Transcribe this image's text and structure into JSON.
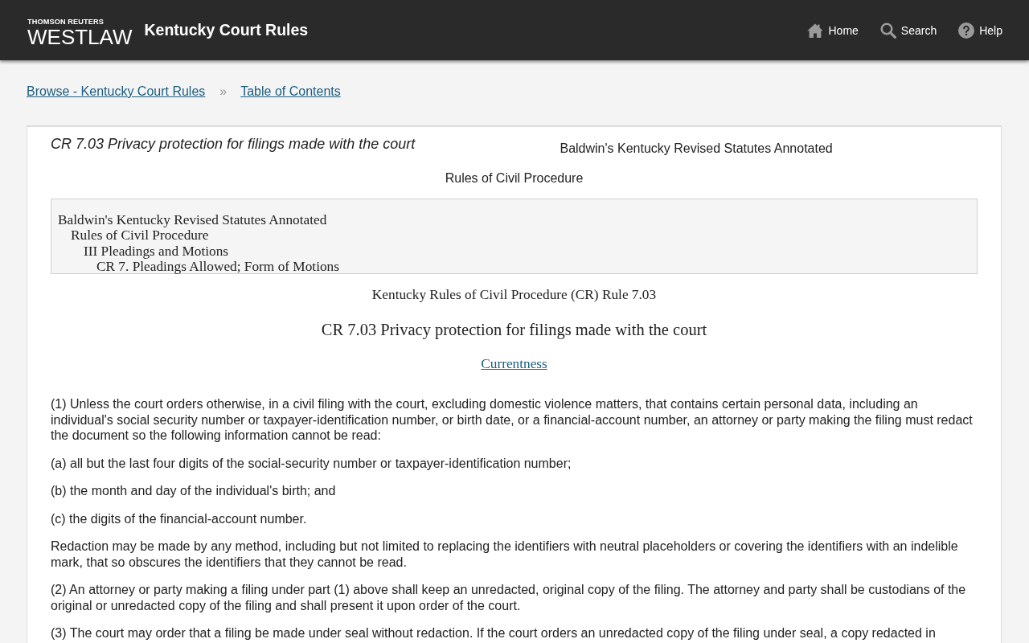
{
  "header": {
    "logo": {
      "company": "THOMSON REUTERS",
      "product": "WESTLAW"
    },
    "title": "Kentucky Court Rules",
    "nav": [
      {
        "kind": "home",
        "label": "Home"
      },
      {
        "kind": "search",
        "label": "Search"
      },
      {
        "kind": "help",
        "label": "Help"
      }
    ]
  },
  "breadcrumbs": {
    "items": [
      "Browse - Kentucky Court Rules",
      "Table of Contents"
    ],
    "separator": "»"
  },
  "document": {
    "running_title": "CR 7.03 Privacy protection for filings made with the court",
    "source": "Baldwin's Kentucky Revised Statutes Annotated",
    "subtitle": "Rules of Civil Procedure",
    "outline": [
      {
        "label": "Baldwin's Kentucky Revised Statutes Annotated",
        "children": [
          {
            "label": "Rules of Civil Procedure",
            "children": [
              {
                "label": "III Pleadings and Motions",
                "children": [
                  {
                    "label": "CR 7. Pleadings Allowed; Form of Motions"
                  }
                ]
              }
            ]
          }
        ]
      }
    ],
    "citation": "Kentucky Rules of Civil Procedure (CR) Rule 7.03",
    "heading": "CR 7.03 Privacy protection for filings made with the court",
    "currentness_link": "Currentness",
    "paragraphs": [
      "(1) Unless the court orders otherwise, in a civil filing with the court, excluding domestic violence matters, that contains certain personal data, including an individual's social security number or taxpayer-identification number, or birth date, or a financial-account number, an attorney or party making the filing must redact the document so the following information cannot be read:",
      "(a) all but the last four digits of the social-security number or taxpayer-identification number;",
      "(b) the month and day of the individual's birth; and",
      "(c) the digits of the financial-account number.",
      "Redaction may be made by any method, including but not limited to replacing the identifiers with neutral placeholders or covering the identifiers with an indelible mark, that so obscures the identifiers that they cannot be read.",
      "(2) An attorney or party making a filing under part (1) above shall keep an unredacted, original copy of the filing. The attorney and party shall be custodians of the original or unredacted copy of the filing and shall present it upon order of the court.",
      "(3) The court may order that a filing be made under seal without redaction. If the court orders an unredacted copy of the filing under seal, a copy redacted in"
    ]
  }
}
